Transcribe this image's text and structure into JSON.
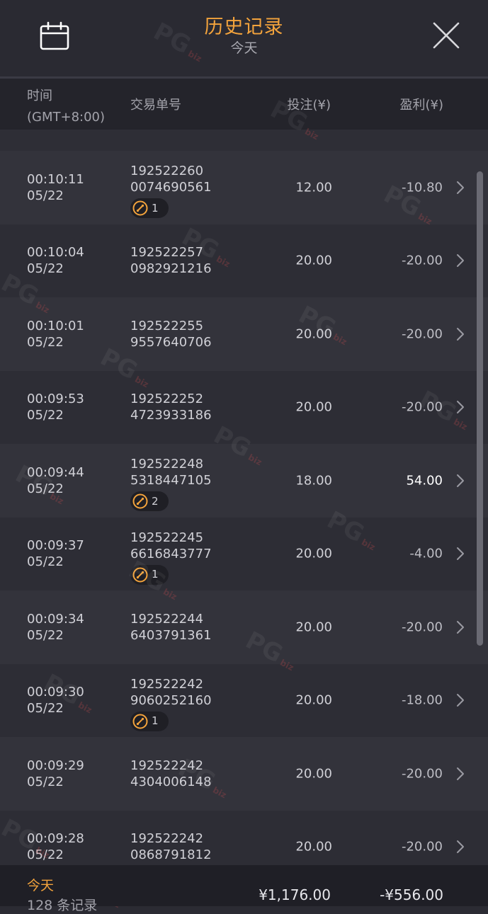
{
  "header": {
    "title": "历史记录",
    "subtitle": "今天"
  },
  "columns": {
    "time_line1": "时间",
    "time_line2": "(GMT+8:00)",
    "order": "交易单号",
    "bet": "投注(¥)",
    "profit": "盈利(¥)"
  },
  "rows": [
    {
      "time": "00:10:11",
      "date": "05/22",
      "order1": "192522260",
      "order2": "0074690561",
      "badge": "1",
      "bet": "12.00",
      "profit": "-10.80"
    },
    {
      "time": "00:10:04",
      "date": "05/22",
      "order1": "192522257",
      "order2": "0982921216",
      "badge": "",
      "bet": "20.00",
      "profit": "-20.00"
    },
    {
      "time": "00:10:01",
      "date": "05/22",
      "order1": "192522255",
      "order2": "9557640706",
      "badge": "",
      "bet": "20.00",
      "profit": "-20.00"
    },
    {
      "time": "00:09:53",
      "date": "05/22",
      "order1": "192522252",
      "order2": "4723933186",
      "badge": "",
      "bet": "20.00",
      "profit": "-20.00"
    },
    {
      "time": "00:09:44",
      "date": "05/22",
      "order1": "192522248",
      "order2": "5318447105",
      "badge": "2",
      "bet": "18.00",
      "profit": "54.00"
    },
    {
      "time": "00:09:37",
      "date": "05/22",
      "order1": "192522245",
      "order2": "6616843777",
      "badge": "1",
      "bet": "20.00",
      "profit": "-4.00"
    },
    {
      "time": "00:09:34",
      "date": "05/22",
      "order1": "192522244",
      "order2": "6403791361",
      "badge": "",
      "bet": "20.00",
      "profit": "-20.00"
    },
    {
      "time": "00:09:30",
      "date": "05/22",
      "order1": "192522242",
      "order2": "9060252160",
      "badge": "1",
      "bet": "20.00",
      "profit": "-18.00"
    },
    {
      "time": "00:09:29",
      "date": "05/22",
      "order1": "192522242",
      "order2": "4304006148",
      "badge": "",
      "bet": "20.00",
      "profit": "-20.00"
    },
    {
      "time": "00:09:28",
      "date": "05/22",
      "order1": "192522242",
      "order2": "0868791812",
      "badge": "",
      "bet": "20.00",
      "profit": "-20.00"
    }
  ],
  "footer": {
    "label": "今天",
    "count": "128 条记录",
    "total_bet": "¥1,176.00",
    "total_profit": "-¥556.00"
  },
  "watermark": {
    "text": "PG",
    "tag": "biz"
  },
  "colors": {
    "accent": "#f3a33c",
    "background": "#2b2b33"
  }
}
